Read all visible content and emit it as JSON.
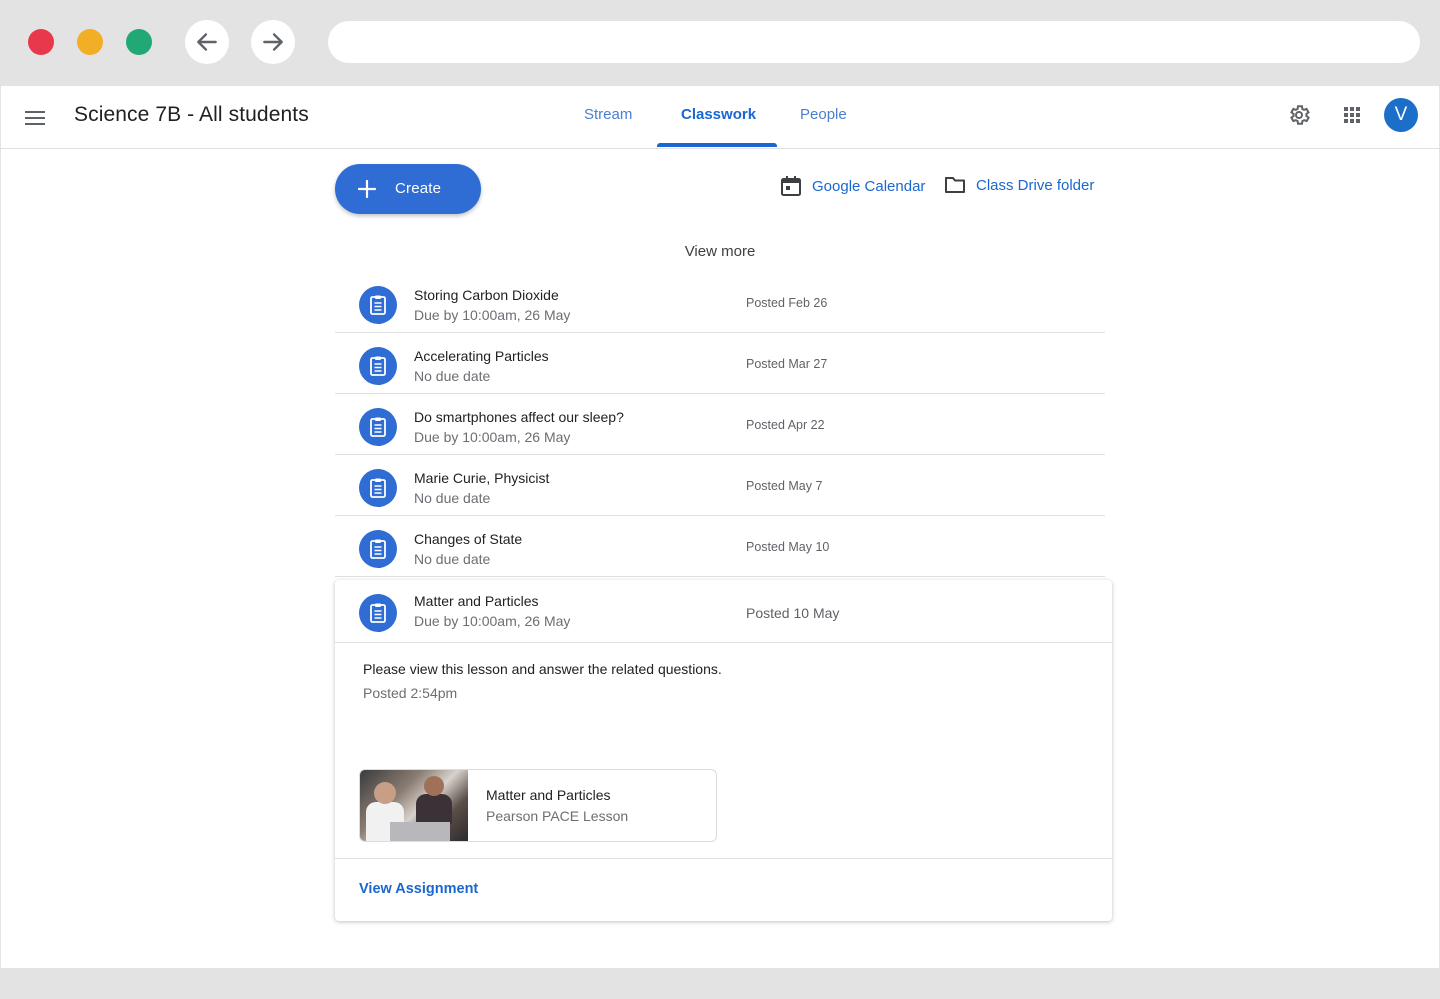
{
  "header": {
    "class_title": "Science 7B - All students",
    "tabs": [
      {
        "label": "Stream"
      },
      {
        "label": "Classwork"
      },
      {
        "label": "People"
      }
    ],
    "avatar_initial": "V"
  },
  "actions": {
    "create_label": "Create",
    "calendar_label": "Google Calendar",
    "drive_label": "Class Drive folder",
    "view_more": "View more"
  },
  "assignments": [
    {
      "title": "Storing Carbon Dioxide",
      "due": "Due by 10:00am, 26 May",
      "posted": "Posted Feb 26"
    },
    {
      "title": "Accelerating Particles",
      "due": "No due date",
      "posted": "Posted Mar 27"
    },
    {
      "title": "Do smartphones affect our sleep?",
      "due": "Due by 10:00am, 26 May",
      "posted": "Posted Apr 22"
    },
    {
      "title": "Marie Curie, Physicist",
      "due": "No due date",
      "posted": "Posted May 7"
    },
    {
      "title": "Changes of State",
      "due": "No due date",
      "posted": "Posted May 10"
    }
  ],
  "expanded": {
    "title": "Matter and Particles",
    "due": "Due by 10:00am, 26 May",
    "posted": "Posted 10 May",
    "instructions": "Please view this lesson and answer the related questions.",
    "posted_time": "Posted 2:54pm",
    "attachment": {
      "title": "Matter and Particles",
      "subtitle": "Pearson PACE Lesson"
    },
    "view_assignment": "View Assignment"
  },
  "colors": {
    "accent": "#1a67d2",
    "button": "#2f6cd4",
    "avatar": "#1b6fc9"
  }
}
